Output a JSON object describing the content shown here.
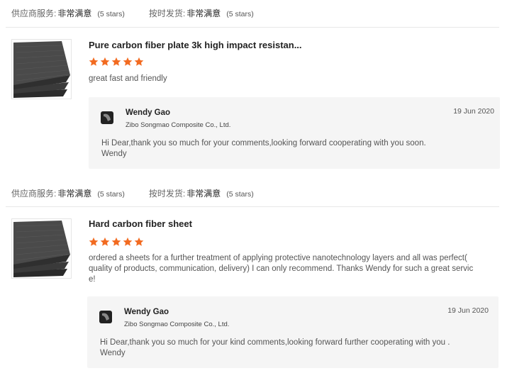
{
  "reviews": [
    {
      "supplier_service_label": "供应商服务:",
      "supplier_service_value": "非常满意",
      "supplier_service_stars": "(5 stars)",
      "on_time_label": "按时发货:",
      "on_time_value": "非常满意",
      "on_time_stars": "(5 stars)",
      "product_title": "Pure carbon fiber plate 3k high impact resistan...",
      "rating": 5,
      "comment": "great fast and friendly",
      "reply": {
        "name": "Wendy Gao",
        "company": "Zibo Songmao Composite Co., Ltd.",
        "date": "19 Jun 2020",
        "message": "Hi Dear,thank you so much for your comments,looking forward cooperating with you soon.\nWendy"
      }
    },
    {
      "supplier_service_label": "供应商服务:",
      "supplier_service_value": "非常满意",
      "supplier_service_stars": "(5 stars)",
      "on_time_label": "按时发货:",
      "on_time_value": "非常满意",
      "on_time_stars": "(5 stars)",
      "product_title": "Hard carbon fiber sheet",
      "rating": 5,
      "comment": "ordered a sheets for a further treatment of applying protective nanotechnology layers and all was perfect( quality of products, communication, delivery) I can only recommend. Thanks Wendy for such a great servic e!",
      "reply": {
        "name": "Wendy Gao",
        "company": "Zibo Songmao Composite Co., Ltd.",
        "date": "19 Jun 2020",
        "message": "Hi Dear,thank you so much for your kind comments,looking forward further cooperating with you .\nWendy"
      }
    }
  ],
  "colors": {
    "star": "#f26b21",
    "reply_bg": "#f5f5f5"
  },
  "icons": {
    "star": "star-icon",
    "supplier_logo": "supplier-logo-icon",
    "product_image": "carbon-fiber-sheet-image"
  }
}
